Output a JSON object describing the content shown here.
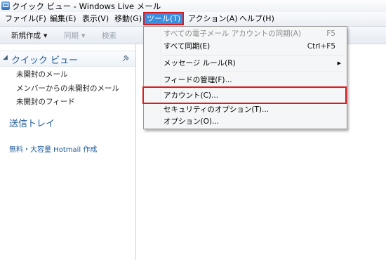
{
  "window": {
    "title": "クイック ビュー - Windows Live メール"
  },
  "menubar": {
    "items": [
      {
        "label": "ファイル(F)"
      },
      {
        "label": "編集(E)"
      },
      {
        "label": "表示(V)"
      },
      {
        "label": "移動(G)"
      },
      {
        "label": "ツール(T)"
      },
      {
        "label": "アクション(A)"
      },
      {
        "label": "ヘルプ(H)"
      }
    ],
    "active_index": 4
  },
  "toolbar": {
    "new_label": "新規作成",
    "sync_label": "同期",
    "search_label": "検索"
  },
  "sidebar": {
    "quick_view_title": "クイック ビュー",
    "items": [
      {
        "label": "未開封のメール"
      },
      {
        "label": "メンバーからの未開封のメール"
      },
      {
        "label": "未開封のフィード"
      }
    ],
    "outbox_label": "送信トレイ",
    "hotmail_link": "無料・大容量 Hotmail 作成"
  },
  "tools_menu": {
    "items": [
      {
        "label": "すべての電子メール アカウントの同期(A)",
        "shortcut": "F5",
        "disabled": true
      },
      {
        "label": "すべて同期(E)",
        "shortcut": "Ctrl+F5",
        "disabled": false
      },
      {
        "label": "メッセージ ルール(R)",
        "submenu": true
      },
      {
        "label": "フィードの管理(F)..."
      },
      {
        "label": "アカウント(C)...",
        "highlighted": true
      },
      {
        "label": "セキュリティのオプション(T)..."
      },
      {
        "label": "オプション(O)..."
      }
    ]
  },
  "colors": {
    "active_menu_bg": "#3a8ee0",
    "highlight_border": "#e0191e",
    "link_blue": "#1f5a99"
  }
}
